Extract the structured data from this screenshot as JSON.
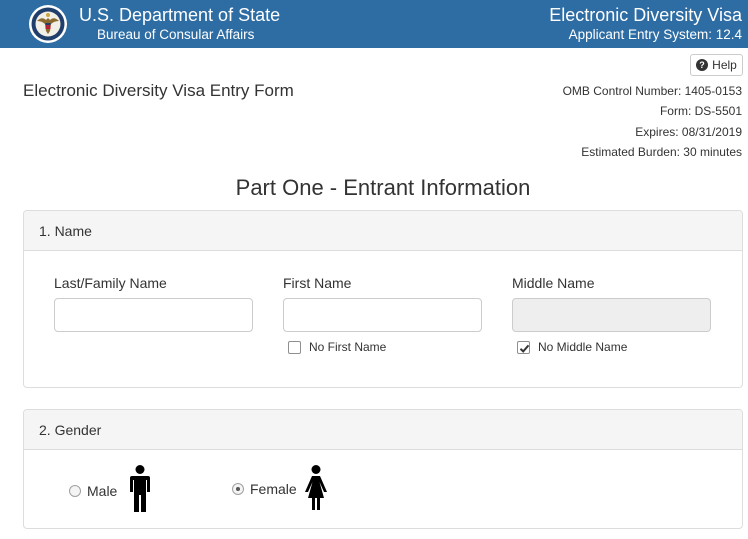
{
  "header": {
    "dept_title": "U.S. Department of State",
    "dept_subtitle": "Bureau of Consular Affairs",
    "system_title": "Electronic Diversity Visa",
    "system_subtitle": "Applicant Entry System: 12.4",
    "seal_icon": "state-department-seal-icon",
    "background_color": "#2e6da4"
  },
  "help": {
    "label": "Help",
    "icon": "question-circle-icon"
  },
  "form_title": "Electronic Diversity Visa Entry Form",
  "omb_info": {
    "control_number": "OMB Control Number: 1405-0153",
    "form": "Form: DS-5501",
    "expires": "Expires: 08/31/2019",
    "burden": "Estimated Burden: 30 minutes"
  },
  "part_title": "Part One - Entrant Information",
  "name_section": {
    "heading": "1. Name",
    "last_name": {
      "label": "Last/Family Name",
      "value": "",
      "placeholder": ""
    },
    "first_name": {
      "label": "First Name",
      "value": "",
      "placeholder": ""
    },
    "middle_name": {
      "label": "Middle Name",
      "value": "",
      "placeholder": "",
      "disabled": true
    },
    "no_first_name": {
      "label": "No First Name",
      "checked": false
    },
    "no_middle_name": {
      "label": "No Middle Name",
      "checked": true
    }
  },
  "gender_section": {
    "heading": "2. Gender",
    "male": {
      "label": "Male",
      "selected": false,
      "icon": "male-person-icon"
    },
    "female": {
      "label": "Female",
      "selected": true,
      "icon": "female-person-icon"
    }
  }
}
